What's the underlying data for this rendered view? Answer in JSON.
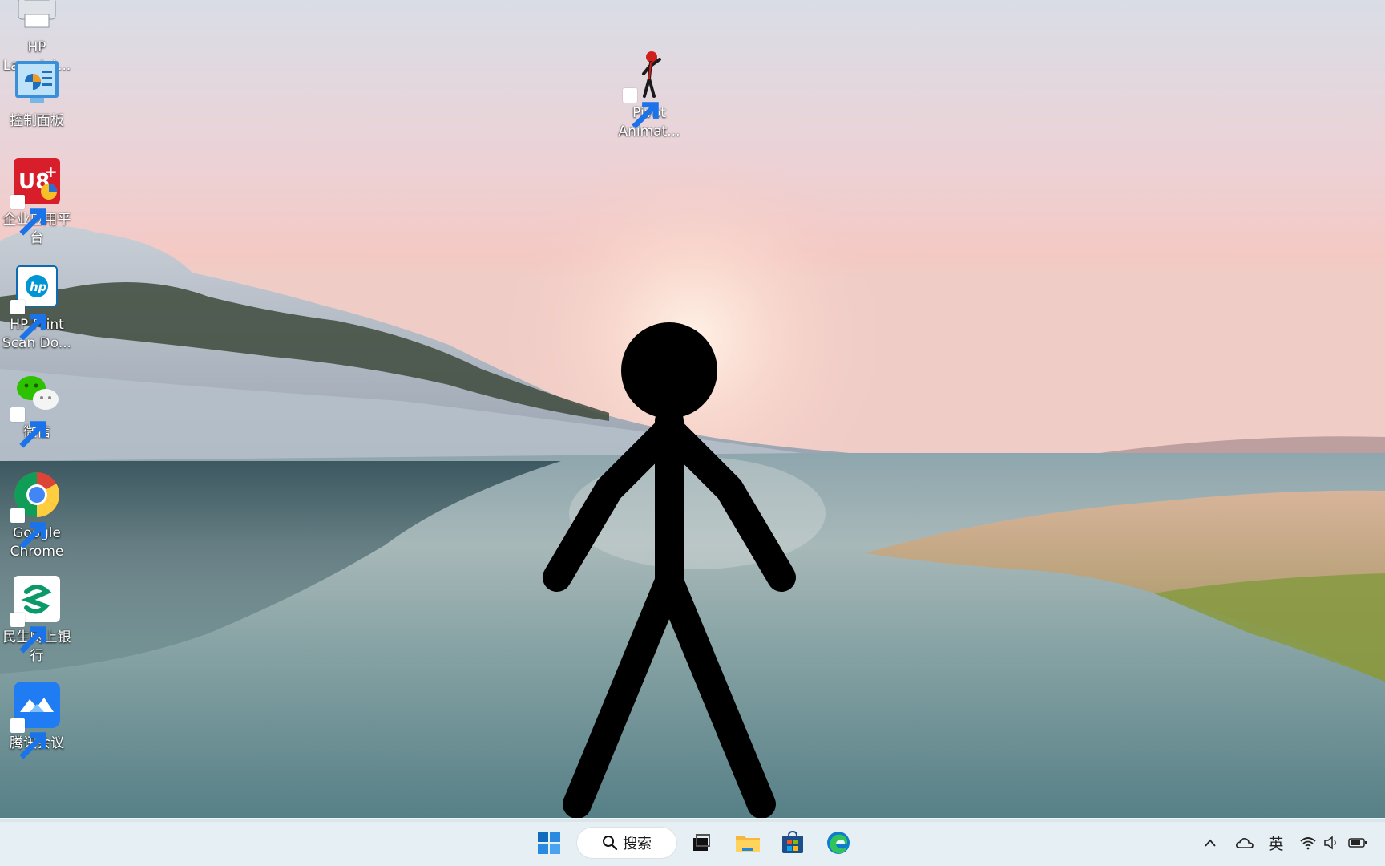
{
  "desktop": {
    "icons": [
      {
        "label": "HP\nLaserJet...",
        "icon": "printer-icon"
      },
      {
        "label": "控制面板",
        "icon": "control-panel-icon"
      },
      {
        "label": "企业应用平\n台",
        "icon": "yonyou-u8-icon"
      },
      {
        "label": "HP Print\nScan Do...",
        "icon": "hp-scan-icon"
      },
      {
        "label": "微信",
        "icon": "wechat-icon"
      },
      {
        "label": "Google\nChrome",
        "icon": "chrome-icon"
      },
      {
        "label": "民生网上银\n行",
        "icon": "minsheng-bank-icon"
      },
      {
        "label": "腾讯会议",
        "icon": "tencent-meeting-icon"
      },
      {
        "label": "Pivot\nAnimat...",
        "icon": "pivot-animator-icon"
      }
    ]
  },
  "taskbar": {
    "search_label": "搜索",
    "pinned": [
      "start-icon",
      "search-icon",
      "task-view-icon",
      "file-explorer-icon",
      "microsoft-store-icon",
      "edge-icon"
    ]
  },
  "tray": {
    "input_method": "英",
    "icons": [
      "chevron-up-icon",
      "onedrive-icon",
      "wifi-icon",
      "volume-icon",
      "battery-icon"
    ]
  },
  "colors": {
    "taskbar_bg": "#e4eef2",
    "windows_blue": "#0f6cbd",
    "stick_figure": "#000000"
  }
}
